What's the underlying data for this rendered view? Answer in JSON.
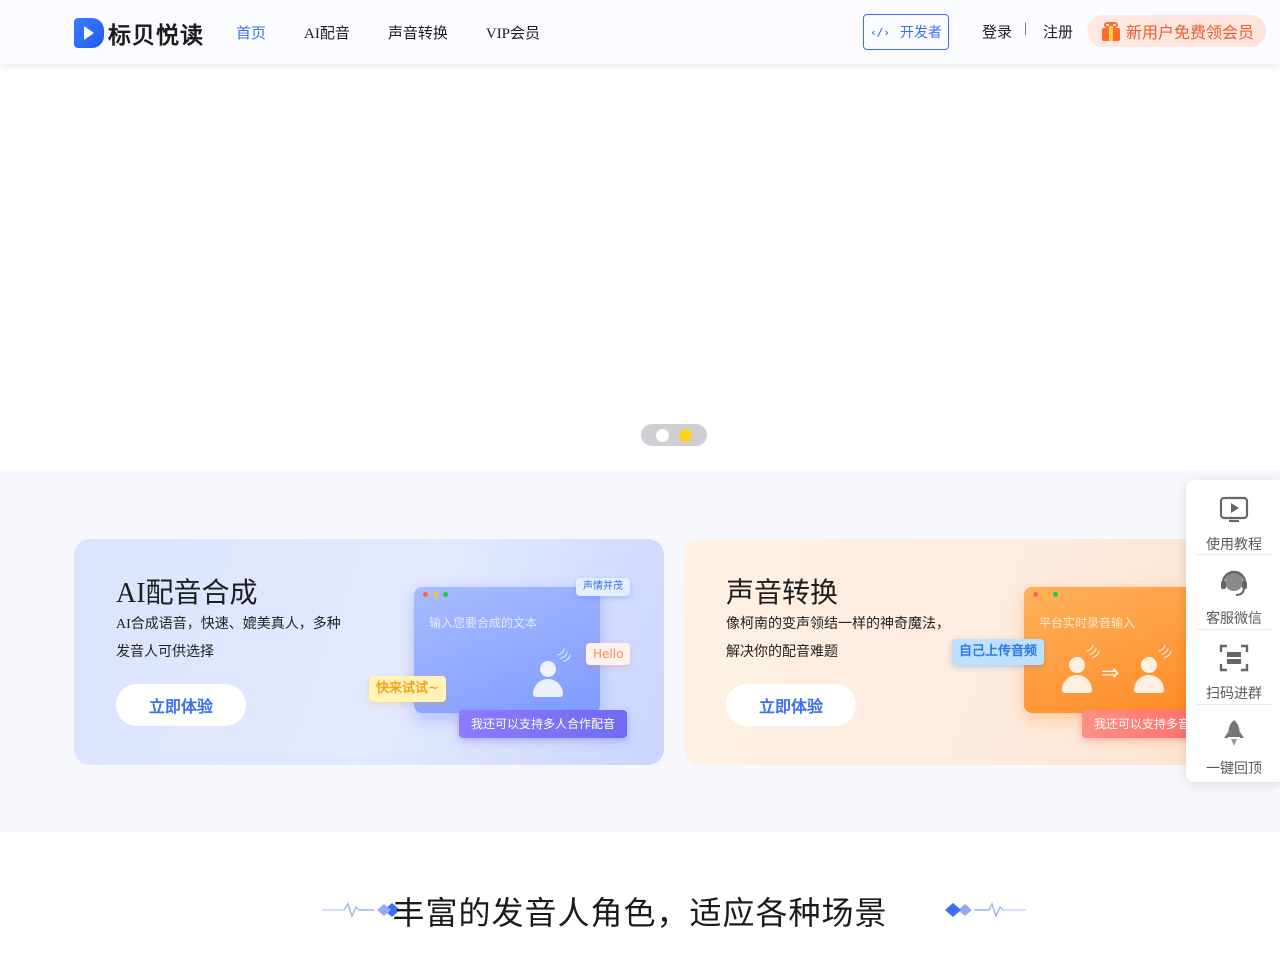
{
  "header": {
    "logo_text": "标贝悦读",
    "nav": [
      {
        "label": "首页",
        "active": true
      },
      {
        "label": "AI配音",
        "active": false
      },
      {
        "label": "声音转换",
        "active": false
      },
      {
        "label": "VIP会员",
        "active": false
      }
    ],
    "developer_label": "开发者",
    "login_label": "登录",
    "separator": "|",
    "register_label": "注册",
    "promo_label": "新用户免费领会员"
  },
  "carousel": {
    "slide_count": 2,
    "active_index": 1
  },
  "features": [
    {
      "title": "AI配音合成",
      "desc_line1": "AI合成语音，快速、媲美真人，多种",
      "desc_line2": "发音人可供选择",
      "button": "立即体验",
      "mock_placeholder": "输入您要合成的文本",
      "tag_emotion": "声情并茂",
      "tag_hello": "Hello",
      "tag_try": "快来试试~",
      "tag_multi": "我还可以支持多人合作配音"
    },
    {
      "title": "声音转换",
      "desc_line1": "像柯南的变声领结一样的神奇魔法，",
      "desc_line2": "解决你的配音难题",
      "button": "立即体验",
      "mock_placeholder": "平台实时录音输入",
      "tag_upload": "自己上传音频",
      "tag_multi": "我还可以支持多音"
    }
  ],
  "float_bar": [
    {
      "label": "使用教程",
      "icon": "play-icon"
    },
    {
      "label": "客服微信",
      "icon": "headset-icon"
    },
    {
      "label": "扫码进群",
      "icon": "scan-icon"
    },
    {
      "label": "一键回顶",
      "icon": "rocket-icon"
    }
  ],
  "roles_section": {
    "title": "丰富的发音人角色，适应各种场景"
  },
  "colors": {
    "accent": "#3a6ff2",
    "promo": "#f05a28",
    "carousel_active": "#ffd21f"
  }
}
